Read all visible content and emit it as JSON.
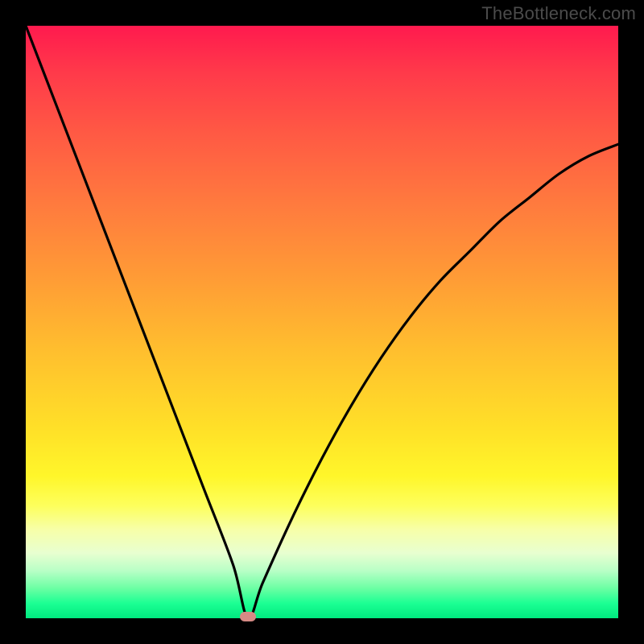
{
  "watermark": "TheBottleneck.com",
  "colors": {
    "frame": "#000000",
    "curve": "#000000",
    "marker": "#d68a85",
    "watermark_text": "#4b4b4b"
  },
  "chart_data": {
    "type": "line",
    "title": "",
    "xlabel": "",
    "ylabel": "",
    "xlim": [
      0,
      100
    ],
    "ylim": [
      0,
      100
    ],
    "series": [
      {
        "name": "bottleneck-curve",
        "x": [
          0,
          5,
          10,
          15,
          20,
          25,
          30,
          35,
          37.5,
          40,
          45,
          50,
          55,
          60,
          65,
          70,
          75,
          80,
          85,
          90,
          95,
          100
        ],
        "values": [
          100,
          87,
          74,
          61,
          48,
          35,
          22,
          9,
          0,
          6,
          17,
          27,
          36,
          44,
          51,
          57,
          62,
          67,
          71,
          75,
          78,
          80
        ]
      }
    ],
    "annotations": [
      {
        "name": "min-marker",
        "x": 37.5,
        "y": 0
      }
    ],
    "background_gradient": {
      "top": "#ff1a4e",
      "mid": "#ffe028",
      "bottom": "#00e97f"
    }
  }
}
